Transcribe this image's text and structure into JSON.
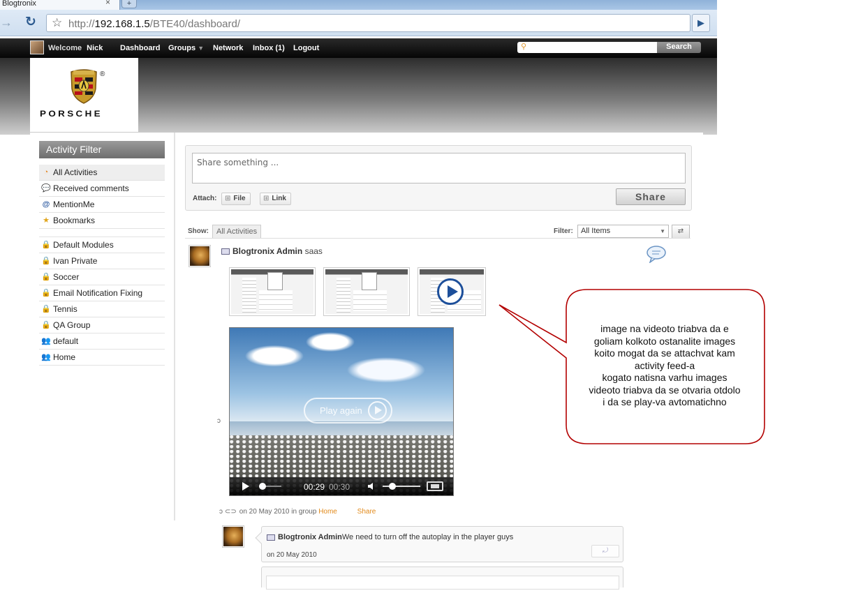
{
  "browser": {
    "tab_title": "Blogtronix",
    "tab_close": "×",
    "new_tab": "+",
    "url_prefix": "http://",
    "url_host": "192.168.1.5",
    "url_path": "/BTE40/dashboard/"
  },
  "topbar": {
    "welcome": "Welcome",
    "username": "Nick",
    "nav": [
      "Dashboard",
      "Groups",
      "Network",
      "Inbox (1)",
      "Logout"
    ],
    "search_button": "Search"
  },
  "logo": {
    "wordmark": "PORSCHE",
    "registered": "®"
  },
  "activity_filter": {
    "title": "Activity Filter",
    "items": [
      {
        "label": "All Activities",
        "icon": "feed-icon"
      },
      {
        "label": "Received comments",
        "icon": "comment-icon"
      },
      {
        "label": "MentionMe",
        "icon": "at-icon"
      },
      {
        "label": "Bookmarks",
        "icon": "star-icon"
      }
    ],
    "groups": [
      {
        "label": "Default Modules",
        "icon": "lock-icon"
      },
      {
        "label": "Ivan Private",
        "icon": "lock-icon"
      },
      {
        "label": "Soccer",
        "icon": "lock-icon"
      },
      {
        "label": "Email Notification Fixing",
        "icon": "lock-icon"
      },
      {
        "label": "Tennis",
        "icon": "lock-icon"
      },
      {
        "label": "QA Group",
        "icon": "lock-icon"
      },
      {
        "label": "default",
        "icon": "group-icon"
      },
      {
        "label": "Home",
        "icon": "group-icon"
      }
    ]
  },
  "composer": {
    "placeholder": "Share something ...",
    "attach_label": "Attach:",
    "file_button": "File",
    "link_button": "Link",
    "share_button": "Share"
  },
  "feed_filter": {
    "show_label": "Show:",
    "show_value": "All Activities",
    "filter_label": "Filter:",
    "filter_value": "All Items"
  },
  "post": {
    "author": "Blogtronix Admin",
    "message": "saas",
    "video": {
      "overlay": "Play again",
      "current_time": "00:29",
      "duration": "00:30"
    },
    "meta_prefix": "on 20 May 2010 in group",
    "group_link": "Home",
    "share_link": "Share"
  },
  "comment": {
    "author": "Blogtronix Admin",
    "text": "We need to turn off the autoplay in the player guys",
    "date": "on 20 May 2010"
  },
  "annotation": {
    "lines": [
      "image na videoto triabva da e",
      "goliam kolkoto ostanalite images",
      "koito mogat da se attachvat kam",
      "activity feed-a",
      "kogato natisna varhu images",
      "videoto triabva da se otvaria otdolo",
      "i da se play-va avtomatichno"
    ],
    "color": "#c00000"
  },
  "colors": {
    "link_orange": "#e28a1b",
    "topbar": "#111111"
  }
}
